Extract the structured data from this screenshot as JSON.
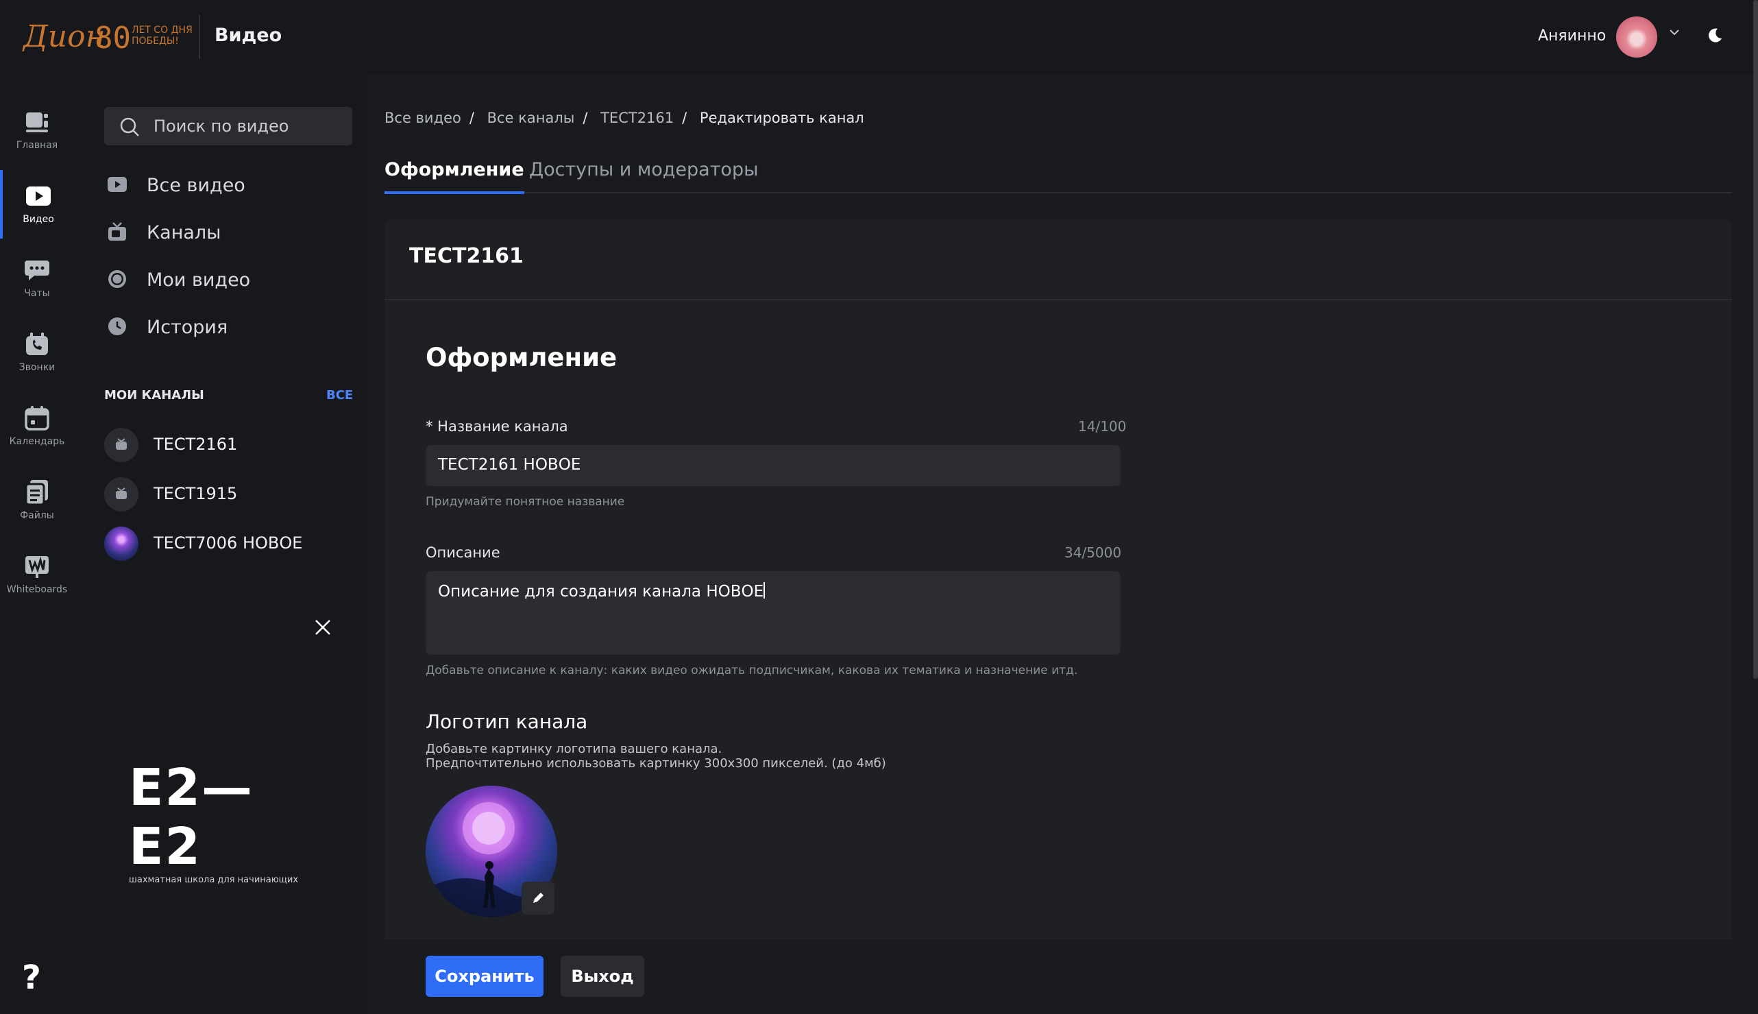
{
  "header": {
    "logo_text": "Дион",
    "logo_number": "80",
    "logo_tagline": "ЛЕТ СО ДНЯ ПОБЕДЫ!",
    "app_title": "Видео",
    "user_name": "Аняинно"
  },
  "rail": {
    "items": [
      {
        "label": "Главная",
        "icon": "home-video-icon"
      },
      {
        "label": "Видео",
        "icon": "play-icon",
        "active": true
      },
      {
        "label": "Чаты",
        "icon": "chat-icon"
      },
      {
        "label": "Звонки",
        "icon": "phone-icon"
      },
      {
        "label": "Календарь",
        "icon": "calendar-icon"
      },
      {
        "label": "Файлы",
        "icon": "files-icon"
      },
      {
        "label": "Whiteboards",
        "icon": "whiteboard-icon"
      }
    ],
    "help_label": "?"
  },
  "sidebar": {
    "search_placeholder": "Поиск по видео",
    "nav": [
      {
        "label": "Все видео",
        "icon": "play-icon"
      },
      {
        "label": "Каналы",
        "icon": "tv-icon"
      },
      {
        "label": "Мои видео",
        "icon": "record-icon"
      },
      {
        "label": "История",
        "icon": "clock-icon"
      }
    ],
    "my_channels_label": "МОИ КАНАЛЫ",
    "all_label": "ВСЕ",
    "channels": [
      {
        "name": "ТЕСТ2161"
      },
      {
        "name": "ТЕСТ1915"
      },
      {
        "name": "ТЕСТ7006 НОВОЕ"
      }
    ],
    "promo_title": "E2—E2",
    "promo_subtitle": "шахматная школа для начинающих"
  },
  "breadcrumb": {
    "items": [
      "Все видео",
      "Все каналы",
      "ТЕСТ2161"
    ],
    "current": "Редактировать канал"
  },
  "tabs": [
    {
      "label": "Оформление",
      "active": true
    },
    {
      "label": "Доступы и модераторы",
      "active": false
    }
  ],
  "card": {
    "title": "ТЕСТ2161",
    "section_title": "Оформление",
    "name_field": {
      "label": "* Название канала",
      "counter": "14/100",
      "value": "ТЕСТ2161 НОВОЕ",
      "hint": "Придумайте понятное название"
    },
    "description_field": {
      "label": "Описание",
      "counter": "34/5000",
      "value": "Описание для создания канала НОВОЕ",
      "hint": "Добавьте описание к каналу: каких видео ожидать подписчикам, какова их тематика и назначение итд."
    },
    "logo": {
      "title": "Логотип канала",
      "hint_line1": "Добавьте картинку логотипа вашего канала.",
      "hint_line2": "Предпочтительно использовать картинку 300х300 пикселей. (до 4мб)"
    },
    "save_label": "Сохранить",
    "exit_label": "Выход"
  },
  "colors": {
    "accent": "#2f6df6",
    "brand_orange": "#c8752f",
    "background": "#1a1b1e"
  }
}
